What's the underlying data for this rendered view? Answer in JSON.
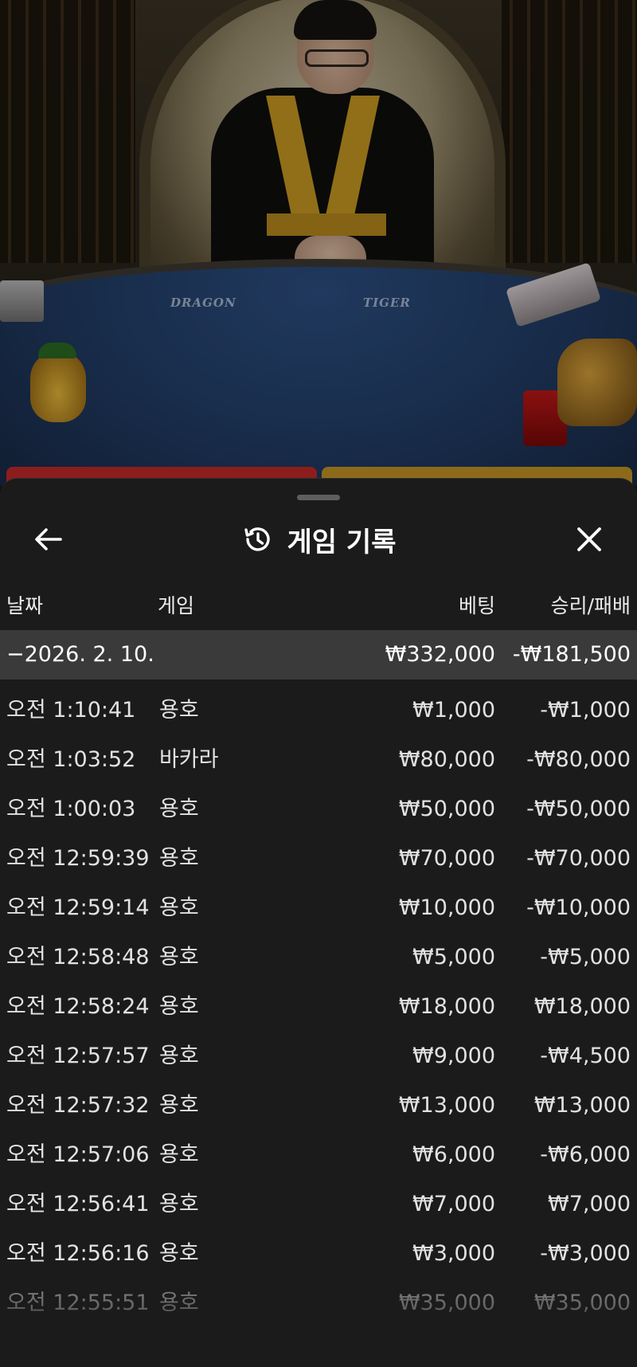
{
  "table": {
    "label_dragon": "DRAGON",
    "label_tiger": "TIGER"
  },
  "sheet": {
    "title": "게임 기록",
    "back_icon": "arrow-left-icon",
    "history_icon": "history-clock-icon",
    "close_icon": "close-icon"
  },
  "columns": {
    "date": "날짜",
    "game": "게임",
    "bet": "베팅",
    "win_loss": "승리/패배"
  },
  "summary": {
    "date": "−2026. 2. 10.",
    "bet": "₩332,000",
    "win_loss": "-₩181,500"
  },
  "rows": [
    {
      "time": "오전 1:10:41",
      "game": "용호",
      "bet": "₩1,000",
      "win_loss": "-₩1,000"
    },
    {
      "time": "오전 1:03:52",
      "game": "바카라",
      "bet": "₩80,000",
      "win_loss": "-₩80,000"
    },
    {
      "time": "오전 1:00:03",
      "game": "용호",
      "bet": "₩50,000",
      "win_loss": "-₩50,000"
    },
    {
      "time": "오전 12:59:39",
      "game": "용호",
      "bet": "₩70,000",
      "win_loss": "-₩70,000"
    },
    {
      "time": "오전 12:59:14",
      "game": "용호",
      "bet": "₩10,000",
      "win_loss": "-₩10,000"
    },
    {
      "time": "오전 12:58:48",
      "game": "용호",
      "bet": "₩5,000",
      "win_loss": "-₩5,000"
    },
    {
      "time": "오전 12:58:24",
      "game": "용호",
      "bet": "₩18,000",
      "win_loss": "₩18,000"
    },
    {
      "time": "오전 12:57:57",
      "game": "용호",
      "bet": "₩9,000",
      "win_loss": "-₩4,500"
    },
    {
      "time": "오전 12:57:32",
      "game": "용호",
      "bet": "₩13,000",
      "win_loss": "₩13,000"
    },
    {
      "time": "오전 12:57:06",
      "game": "용호",
      "bet": "₩6,000",
      "win_loss": "-₩6,000"
    },
    {
      "time": "오전 12:56:41",
      "game": "용호",
      "bet": "₩7,000",
      "win_loss": "₩7,000"
    },
    {
      "time": "오전 12:56:16",
      "game": "용호",
      "bet": "₩3,000",
      "win_loss": "-₩3,000"
    },
    {
      "time": "오전 12:55:51",
      "game": "용호",
      "bet": "₩35,000",
      "win_loss": "₩35,000"
    }
  ]
}
